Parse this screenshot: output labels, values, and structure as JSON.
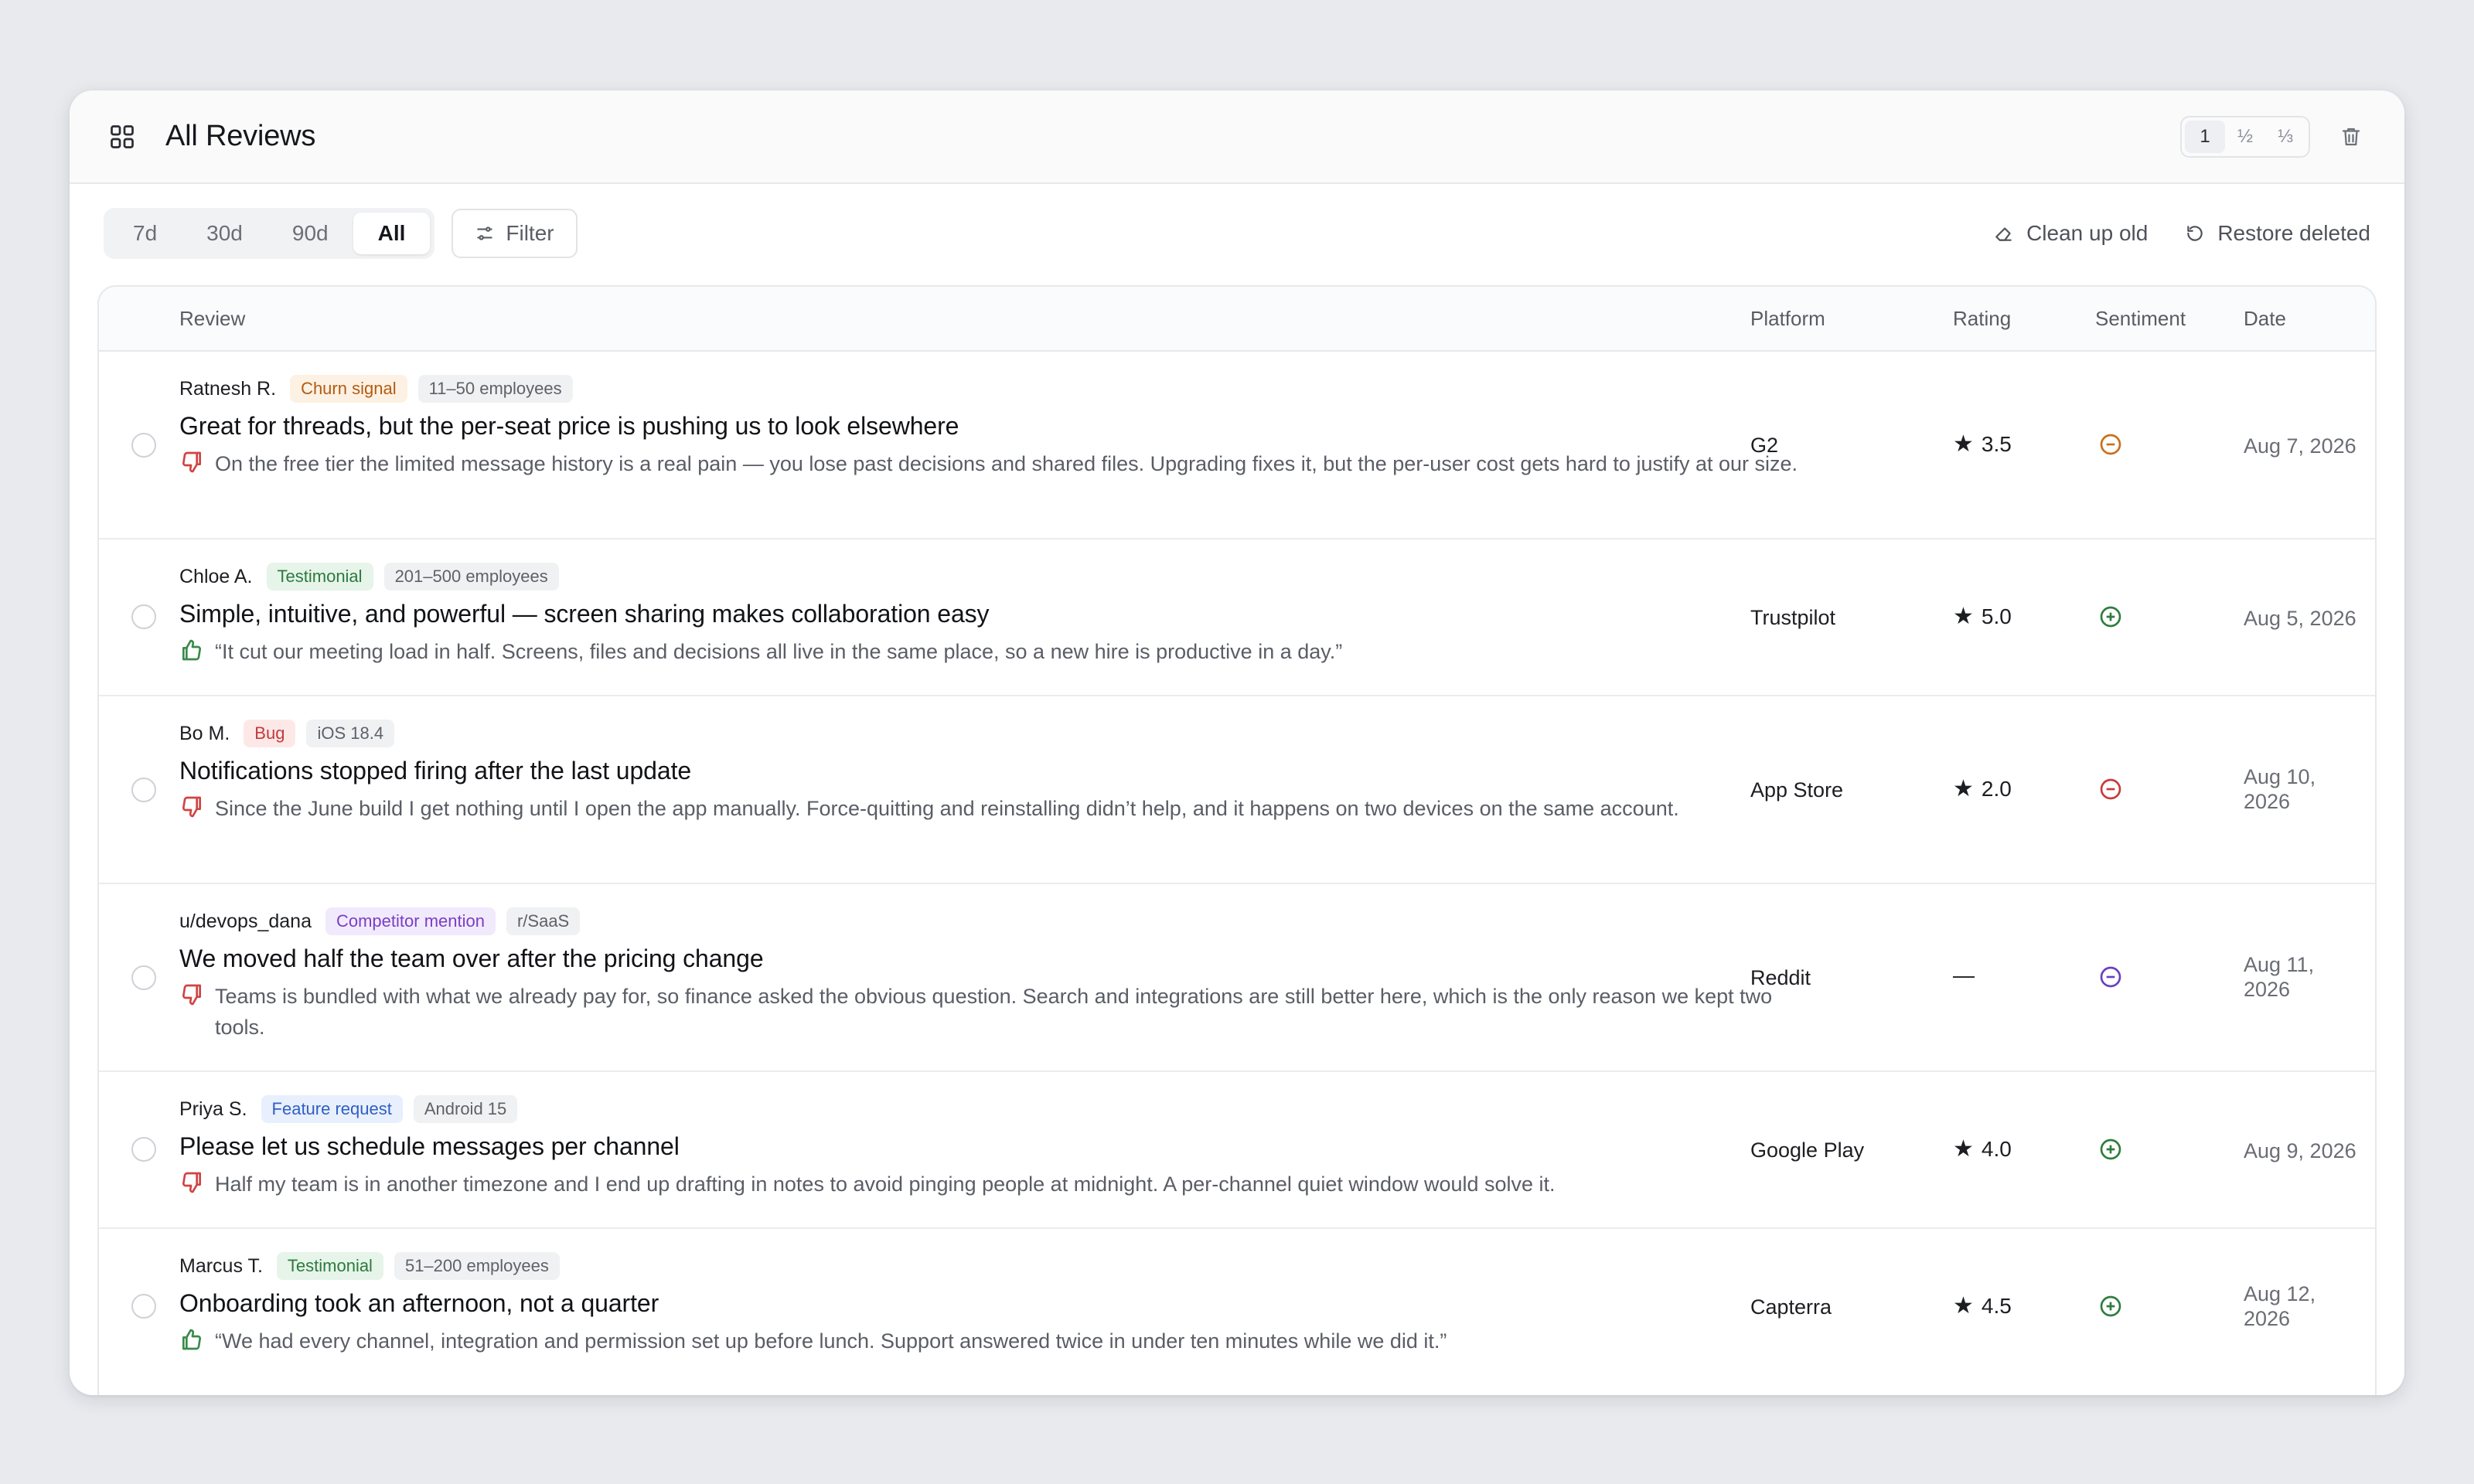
{
  "header": {
    "title": "All Reviews",
    "size_options": [
      "1",
      "½",
      "⅓"
    ],
    "active_size": "1"
  },
  "toolbar": {
    "ranges": [
      "7d",
      "30d",
      "90d",
      "All"
    ],
    "active_range": "All",
    "filter_label": "Filter",
    "cleanup_label": "Clean up old",
    "restore_label": "Restore deleted"
  },
  "table": {
    "columns": {
      "review": "Review",
      "platform": "Platform",
      "rating": "Rating",
      "sentiment": "Sentiment",
      "date": "Date"
    },
    "rows": [
      {
        "author": "Ratnesh R.",
        "tag": "Churn signal",
        "meta": "11–50 employees",
        "title": "Great for threads, but the per-seat price is pushing us to look elsewhere",
        "body": "On the free tier the limited message history is a real pain — you lose past decisions and shared files. Upgrading fixes it, but the per-user cost gets hard to justify at our size.",
        "thumb": "thumbs-down",
        "platform": "G2",
        "rating": "3.5",
        "sentiment": "negative",
        "sentiment_color": "#c8701c",
        "date": "Aug 7, 2026"
      },
      {
        "author": "Chloe A.",
        "tag": "Testimonial",
        "meta": "201–500 employees",
        "title": "Simple, intuitive, and powerful — screen sharing makes collaboration easy",
        "body": "“It cut our meeting load in half. Screens, files and decisions all live in the same place, so a new hire is productive in a day.”",
        "thumb": "thumbs-up",
        "platform": "Trustpilot",
        "rating": "5.0",
        "sentiment": "positive",
        "sentiment_color": "#2f7d3e",
        "date": "Aug 5, 2026"
      },
      {
        "author": "Bo M.",
        "tag": "Bug",
        "meta": "iOS 18.4",
        "title": "Notifications stopped firing after the last update",
        "body": "Since the June build I get nothing until I open the app manually. Force-quitting and reinstalling didn’t help, and it happens on two devices on the same account.",
        "thumb": "thumbs-down",
        "platform": "App Store",
        "rating": "2.0",
        "sentiment": "negative",
        "sentiment_color": "#c83a3a",
        "date": "Aug 10, 2026"
      },
      {
        "author": "u/devops_dana",
        "tag": "Competitor mention",
        "meta": "r/SaaS",
        "title": "We moved half the team over after the pricing change",
        "body": "Teams is bundled with what we already pay for, so finance asked the obvious question. Search and integrations are still better here, which is the only reason we kept two tools.",
        "thumb": "thumbs-down",
        "platform": "Reddit",
        "rating": "—",
        "sentiment": "negative",
        "sentiment_color": "#6a3fc0",
        "date": "Aug 11, 2026"
      },
      {
        "author": "Priya S.",
        "tag": "Feature request",
        "meta": "Android 15",
        "title": "Please let us schedule messages per channel",
        "body": "Half my team is in another timezone and I end up drafting in notes to avoid pinging people at midnight. A per-channel quiet window would solve it.",
        "thumb": "thumbs-down",
        "platform": "Google Play",
        "rating": "4.0",
        "sentiment": "positive",
        "sentiment_color": "#2f7d3e",
        "date": "Aug 9, 2026"
      },
      {
        "author": "Marcus T.",
        "tag": "Testimonial",
        "meta": "51–200 employees",
        "title": "Onboarding took an afternoon, not a quarter",
        "body": "“We had every channel, integration and permission set up before lunch. Support answered twice in under ten minutes while we did it.”",
        "thumb": "thumbs-up",
        "platform": "Capterra",
        "rating": "4.5",
        "sentiment": "positive",
        "sentiment_color": "#2f7d3e",
        "date": "Aug 12, 2026"
      }
    ]
  }
}
